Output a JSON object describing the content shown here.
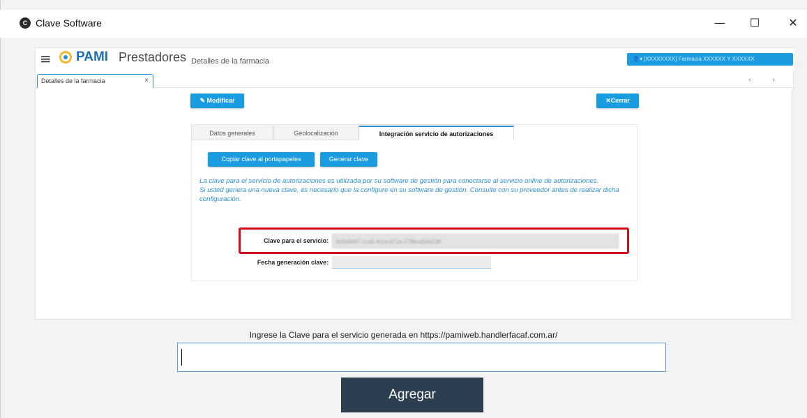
{
  "window": {
    "title": "Clave Software",
    "controls": {
      "minimize": "—",
      "maximize": "☐",
      "close": "✕"
    }
  },
  "web": {
    "brand_pami": "PAMI",
    "brand_prestadores": "Prestadores",
    "breadcrumb": "Detalles de la farmacia",
    "user_menu": "[XXXXXXXX] Farmacia XXXXXX Y XXXXXX",
    "doc_tab": {
      "label": "Detalles de la farmacia",
      "close": "×"
    },
    "nav": "‹ ›",
    "buttons": {
      "modificar": "Modificar",
      "cerrar": "Cerrar",
      "copiar": "Copiar clave al portapapeles",
      "generar": "Generar clave"
    },
    "tabs": [
      "Datos generales",
      "Geolocalización",
      "Integración servicio de autorizaciones"
    ],
    "info_lines": [
      "La clave para el servicio de autorizaciones es utilizada por su software de gestión para conectarse al servicio online de autorizaciones.",
      "Si usted genera una nueva clave, es necesario que la configure en su software de gestión. Consulte con su proveedor antes de realizar dicha configuración."
    ],
    "clave_label": "Clave para el servicio:",
    "clave_value": "3e5b8d47-1ca5-4cca-b71e-578bca5da106",
    "fecha_label": "Fecha generación clave:",
    "fecha_value": ""
  },
  "form": {
    "prompt": "Ingrese la Clave para el servicio generada en https://pamiweb.handlerfacaf.com.ar/",
    "input_value": "",
    "submit": "Agregar"
  },
  "colors": {
    "accent": "#1a9de0",
    "highlight": "#d40b1c",
    "submit_bg": "#2c3e50"
  }
}
